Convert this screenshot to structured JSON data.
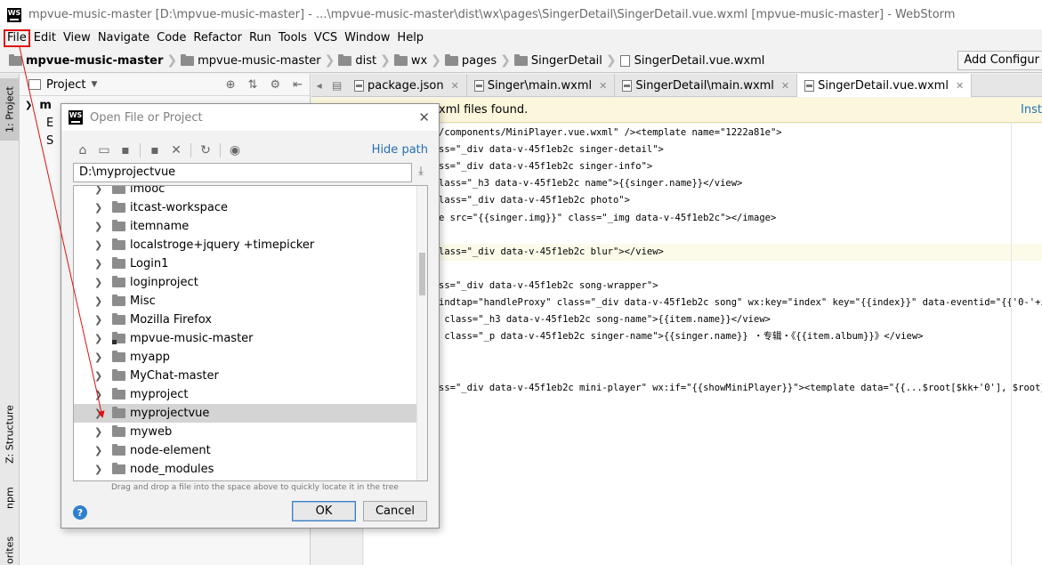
{
  "window": {
    "title": "mpvue-music-master [D:\\mpvue-music-master] - ...\\mpvue-music-master\\dist\\wx\\pages\\SingerDetail\\SingerDetail.vue.wxml [mpvue-music-master] - WebStorm",
    "logo_text": "WS"
  },
  "menu": [
    "File",
    "Edit",
    "View",
    "Navigate",
    "Code",
    "Refactor",
    "Run",
    "Tools",
    "VCS",
    "Window",
    "Help"
  ],
  "breadcrumbs": [
    "mpvue-music-master",
    "mpvue-music-master",
    "dist",
    "wx",
    "pages",
    "SingerDetail",
    "SingerDetail.vue.wxml"
  ],
  "toolbar": {
    "add_config_label": "Add Configur"
  },
  "left_tool_tabs": {
    "project": "1: Project",
    "structure": "Z: Structure",
    "npm": "npm",
    "favorites": "orites"
  },
  "project_panel": {
    "title": "Project",
    "tree": [
      "m",
      "E",
      "S"
    ]
  },
  "editor": {
    "tabs": [
      "package.json",
      "Singer\\main.wxml",
      "SingerDetail\\main.wxml",
      "SingerDetail.vue.wxml"
    ],
    "notification": "xml files found.",
    "notification_link": "Inst",
    "code_lines": [
      "/components/MiniPlayer.vue.wxml\" /><template name=\"1222a81e\">",
      "ss=\"_div data-v-45f1eb2c singer-detail\">",
      "ss=\"_div data-v-45f1eb2c singer-info\">",
      "lass=\"_h3 data-v-45f1eb2c name\">{{singer.name}}</view>",
      "lass=\"_div data-v-45f1eb2c photo\">",
      "e src=\"{{singer.img}}\" class=\"_img data-v-45f1eb2c\"></image>",
      "",
      "lass=\"_div data-v-45f1eb2c blur\"></view>",
      "",
      "ss=\"_div data-v-45f1eb2c song-wrapper\">",
      "indtap=\"handleProxy\" class=\"_div data-v-45f1eb2c song\" wx:key=\"index\" key=\"{{index}}\" data-eventid=\"{{'0-'+index}}\"",
      " class=\"_h3 data-v-45f1eb2c song-name\">{{item.name}}</view>",
      " class=\"_p data-v-45f1eb2c singer-name\">{{singer.name}} ・专辑・《{{item.album}}》</view>",
      "",
      "",
      "ss=\"_div data-v-45f1eb2c mini-player\" wx:if=\"{{showMiniPlayer}}\"><template data=\"{{...$root[$kk+'0'], $root}}\" is"
    ]
  },
  "dialog": {
    "title": "Open File or Project",
    "hide_path_label": "Hide path",
    "path_value": "D:\\myprojectvue",
    "folders": [
      {
        "name": "imooc",
        "selected": false,
        "project": false
      },
      {
        "name": "itcast-workspace",
        "selected": false,
        "project": false
      },
      {
        "name": "itemname",
        "selected": false,
        "project": false
      },
      {
        "name": "localstroge+jquery +timepicker",
        "selected": false,
        "project": false
      },
      {
        "name": "Login1",
        "selected": false,
        "project": false
      },
      {
        "name": "loginproject",
        "selected": false,
        "project": false
      },
      {
        "name": "Misc",
        "selected": false,
        "project": false
      },
      {
        "name": "Mozilla Firefox",
        "selected": false,
        "project": false
      },
      {
        "name": "mpvue-music-master",
        "selected": false,
        "project": true
      },
      {
        "name": "myapp",
        "selected": false,
        "project": false
      },
      {
        "name": "MyChat-master",
        "selected": false,
        "project": false
      },
      {
        "name": "myproject",
        "selected": false,
        "project": false
      },
      {
        "name": "myprojectvue",
        "selected": true,
        "project": false
      },
      {
        "name": "myweb",
        "selected": false,
        "project": false
      },
      {
        "name": "node-element",
        "selected": false,
        "project": false
      },
      {
        "name": "node_modules",
        "selected": false,
        "project": false
      }
    ],
    "drag_hint": "Drag and drop a file into the space above to quickly locate it in the tree",
    "ok_label": "OK",
    "cancel_label": "Cancel",
    "help_label": "?"
  },
  "colors": {
    "link": "#2470b3",
    "highlight_box": "#e01010",
    "notification_bg": "#fcf7dc",
    "selected_row": "#d4d4d4"
  }
}
